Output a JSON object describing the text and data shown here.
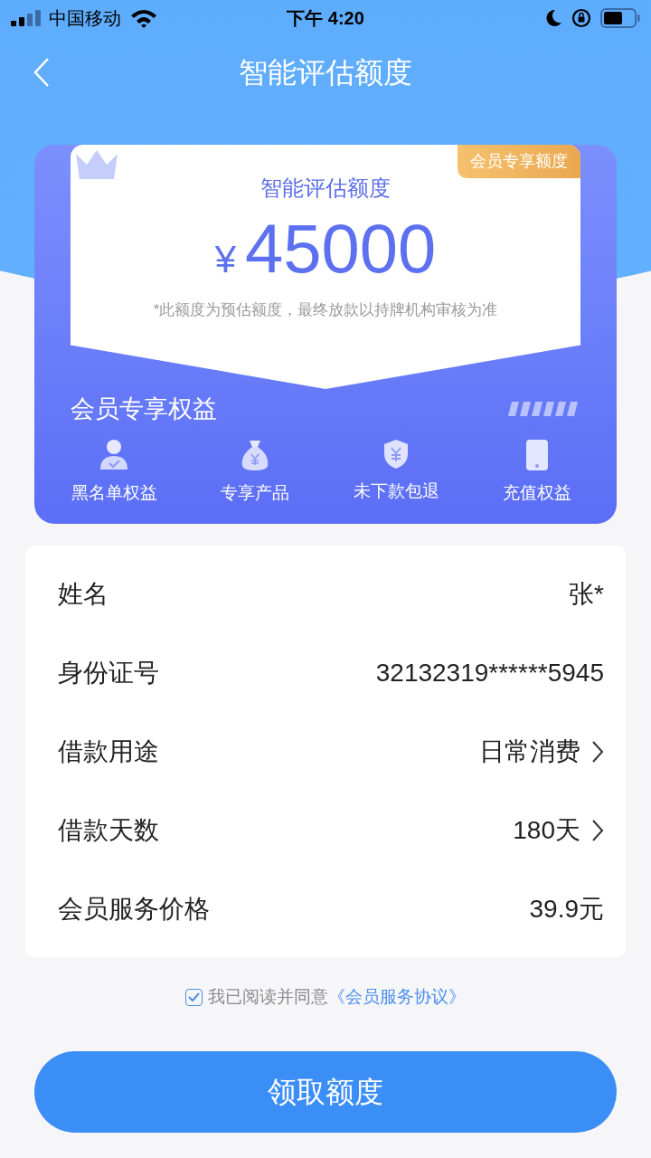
{
  "status_bar": {
    "carrier": "中国移动",
    "time": "下午 4:20"
  },
  "nav": {
    "title": "智能评估额度"
  },
  "quota_card": {
    "badge": "会员专享额度",
    "title": "智能评估额度",
    "currency": "¥",
    "amount": "45000",
    "note": "*此额度为预估额度，最终放款以持牌机构审核为准"
  },
  "benefits": {
    "title": "会员专享权益",
    "items": [
      {
        "kind": "person",
        "label": "黑名单权益"
      },
      {
        "kind": "moneybag",
        "label": "专享产品"
      },
      {
        "kind": "shield",
        "label": "未下款包退"
      },
      {
        "kind": "phone",
        "label": "充值权益"
      }
    ]
  },
  "form": {
    "rows": [
      {
        "kind": "text",
        "label": "姓名",
        "value": "张*"
      },
      {
        "kind": "text",
        "label": "身份证号",
        "value": "32132319******5945"
      },
      {
        "kind": "select",
        "label": "借款用途",
        "value": "日常消费"
      },
      {
        "kind": "select",
        "label": "借款天数",
        "value": "180天"
      },
      {
        "kind": "text",
        "label": "会员服务价格",
        "value": "39.9元"
      }
    ]
  },
  "agreement": {
    "checked": true,
    "text": "我已阅读并同意",
    "link": "《会员服务协议》"
  },
  "submit_button": "领取额度"
}
